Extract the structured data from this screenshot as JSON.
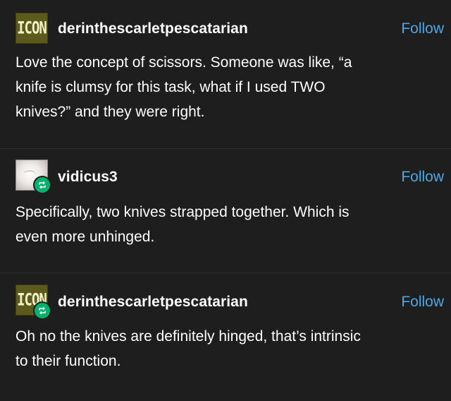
{
  "posts": [
    {
      "avatar_text": "ICON",
      "username": "derinthescarletpescatarian",
      "follow_label": "Follow",
      "lines": [
        "Love the concept of scissors. Someone was like, “a",
        "knife is clumsy for this task, what if I used TWO",
        "knives?” and they were right."
      ]
    },
    {
      "username": "vidicus3",
      "follow_label": "Follow",
      "lines": [
        "Specifically, two knives strapped together. Which is",
        "even more unhinged."
      ]
    },
    {
      "avatar_text": "ICON",
      "username": "derinthescarletpescatarian",
      "follow_label": "Follow",
      "lines": [
        "Oh no the knives are definitely hinged, that’s intrinsic",
        "to their function."
      ]
    }
  ],
  "icons": {
    "reblog": "reblog-icon"
  },
  "colors": {
    "background": "#1e1e1e",
    "text": "#ffffff",
    "follow": "#4ea6e6",
    "reblog_badge": "#00b26e",
    "icon_avatar_bg": "#5c5a1c"
  }
}
